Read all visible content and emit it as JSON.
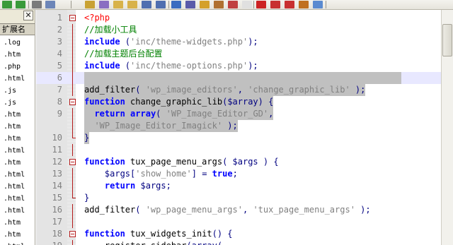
{
  "toolbar": {
    "buttons": [
      {
        "name": "undo-icon",
        "color": "#3a9a3a"
      },
      {
        "name": "redo-icon",
        "color": "#3a9a3a"
      },
      {
        "name": "cut-icon",
        "color": "#7a7a7a"
      },
      {
        "name": "copy-icon",
        "color": "#6d86b8"
      },
      {
        "name": "find-icon",
        "color": "#c9a233"
      },
      {
        "name": "replace-icon",
        "color": "#8a6fc2"
      },
      {
        "name": "zoom-in-icon",
        "color": "#d8b24a"
      },
      {
        "name": "zoom-out-icon",
        "color": "#d8b24a"
      },
      {
        "name": "sync-vertical-icon",
        "color": "#4f6fb0"
      },
      {
        "name": "sync-horizontal-icon",
        "color": "#4f6fb0"
      },
      {
        "name": "word-wrap-icon",
        "color": "#3a6cc0"
      },
      {
        "name": "show-all-chars-icon",
        "color": "#5a5aaa"
      },
      {
        "name": "indent-guide-icon",
        "color": "#d4a02a"
      },
      {
        "name": "user-lang-icon",
        "color": "#b07030"
      },
      {
        "name": "doc-map-icon",
        "color": "#c04040"
      },
      {
        "name": "function-list-icon",
        "color": "#e0e0e0"
      },
      {
        "name": "record-macro-icon",
        "color": "#cc2222"
      },
      {
        "name": "stop-macro-icon",
        "color": "#c83030"
      },
      {
        "name": "play-macro-icon",
        "color": "#c83030"
      },
      {
        "name": "run-macro-icon",
        "color": "#c07020"
      },
      {
        "name": "save-macro-icon",
        "color": "#5a8ad0"
      }
    ]
  },
  "panel": {
    "title": "扩展名",
    "close_glyph": "✕",
    "files": [
      ".log",
      ".htm",
      ".php",
      ".html",
      ".js",
      ".js",
      ".htm",
      ".htm",
      ".htm",
      ".html",
      ".htm",
      ".html",
      ".html",
      ".html",
      ".html",
      ".htm",
      ".htm",
      ".html"
    ]
  },
  "editor": {
    "current_line": 6,
    "lines": [
      {
        "n": "1",
        "fold": "box",
        "tokens": [
          {
            "t": "<?php",
            "c": "php"
          }
        ]
      },
      {
        "n": "2",
        "fold": "vline",
        "tokens": [
          {
            "t": "//加载小工具",
            "c": "cmt"
          }
        ]
      },
      {
        "n": "3",
        "fold": "vline",
        "tokens": [
          {
            "t": "include",
            "c": "kw"
          },
          {
            "t": " (",
            "c": "op"
          },
          {
            "t": "'inc/theme-widgets.php'",
            "c": "str"
          },
          {
            "t": ");",
            "c": "op"
          }
        ]
      },
      {
        "n": "4",
        "fold": "vline",
        "tokens": [
          {
            "t": "//加载主题后台配置",
            "c": "cmt"
          }
        ]
      },
      {
        "n": "5",
        "fold": "vline",
        "tokens": [
          {
            "t": "include",
            "c": "kw"
          },
          {
            "t": " (",
            "c": "op"
          },
          {
            "t": "'inc/theme-options.php'",
            "c": "str"
          },
          {
            "t": ");",
            "c": "op"
          }
        ]
      },
      {
        "n": "6",
        "fold": "vline",
        "sel": true,
        "tokens": [
          {
            "t": "",
            "c": ""
          }
        ]
      },
      {
        "n": "7",
        "fold": "vline",
        "sel": true,
        "tokens": [
          {
            "t": "add_filter",
            "c": ""
          },
          {
            "t": "( ",
            "c": "op"
          },
          {
            "t": "'wp_image_editors'",
            "c": "str"
          },
          {
            "t": ", ",
            "c": "op"
          },
          {
            "t": "'change_graphic_lib'",
            "c": "str"
          },
          {
            "t": " );",
            "c": "op"
          }
        ]
      },
      {
        "n": "8",
        "fold": "box",
        "sel": true,
        "tokens": [
          {
            "t": "function",
            "c": "kw"
          },
          {
            "t": " change_graphic_lib",
            "c": ""
          },
          {
            "t": "(",
            "c": "op"
          },
          {
            "t": "$array",
            "c": "var"
          },
          {
            "t": ") {",
            "c": "op"
          }
        ]
      },
      {
        "n": "9",
        "fold": "vline",
        "sel": true,
        "tokens": [
          {
            "t": "  ",
            "c": ""
          },
          {
            "t": "return",
            "c": "kw"
          },
          {
            "t": " ",
            "c": ""
          },
          {
            "t": "array",
            "c": "kw"
          },
          {
            "t": "( ",
            "c": "op"
          },
          {
            "t": "'WP_Image_Editor_GD'",
            "c": "str"
          },
          {
            "t": ",",
            "c": "op"
          }
        ]
      },
      {
        "n": "",
        "fold": "vline",
        "sel": true,
        "tokens": [
          {
            "t": "  ",
            "c": ""
          },
          {
            "t": "'WP_Image_Editor_Imagick'",
            "c": "str"
          },
          {
            "t": " );",
            "c": "op"
          }
        ]
      },
      {
        "n": "10",
        "fold": "corner",
        "sel": true,
        "tokens": [
          {
            "t": "}",
            "c": "op"
          }
        ]
      },
      {
        "n": "11",
        "fold": "vline",
        "tokens": [
          {
            "t": "",
            "c": ""
          }
        ]
      },
      {
        "n": "12",
        "fold": "box",
        "tokens": [
          {
            "t": "function",
            "c": "kw"
          },
          {
            "t": " tux_page_menu_args",
            "c": ""
          },
          {
            "t": "( ",
            "c": "op"
          },
          {
            "t": "$args",
            "c": "var"
          },
          {
            "t": " ) {",
            "c": "op"
          }
        ]
      },
      {
        "n": "13",
        "fold": "vline",
        "tokens": [
          {
            "t": "    ",
            "c": ""
          },
          {
            "t": "$args",
            "c": "var"
          },
          {
            "t": "[",
            "c": "op"
          },
          {
            "t": "'show_home'",
            "c": "str"
          },
          {
            "t": "] = ",
            "c": "op"
          },
          {
            "t": "true",
            "c": "kw"
          },
          {
            "t": ";",
            "c": "op"
          }
        ]
      },
      {
        "n": "14",
        "fold": "vline",
        "tokens": [
          {
            "t": "    ",
            "c": ""
          },
          {
            "t": "return",
            "c": "kw"
          },
          {
            "t": " ",
            "c": ""
          },
          {
            "t": "$args",
            "c": "var"
          },
          {
            "t": ";",
            "c": "op"
          }
        ]
      },
      {
        "n": "15",
        "fold": "corner",
        "tokens": [
          {
            "t": "}",
            "c": "op"
          }
        ]
      },
      {
        "n": "16",
        "fold": "vline",
        "tokens": [
          {
            "t": "add_filter",
            "c": ""
          },
          {
            "t": "( ",
            "c": "op"
          },
          {
            "t": "'wp_page_menu_args'",
            "c": "str"
          },
          {
            "t": ", ",
            "c": "op"
          },
          {
            "t": "'tux_page_menu_args'",
            "c": "str"
          },
          {
            "t": " );",
            "c": "op"
          }
        ]
      },
      {
        "n": "17",
        "fold": "vline",
        "tokens": [
          {
            "t": "",
            "c": ""
          }
        ]
      },
      {
        "n": "18",
        "fold": "box",
        "tokens": [
          {
            "t": "function",
            "c": "kw"
          },
          {
            "t": " tux_widgets_init",
            "c": ""
          },
          {
            "t": "() {",
            "c": "op"
          }
        ]
      },
      {
        "n": "19",
        "fold": "vline",
        "tokens": [
          {
            "t": "    register_sidebar",
            "c": ""
          },
          {
            "t": "(array(",
            "c": "op"
          }
        ]
      }
    ]
  }
}
